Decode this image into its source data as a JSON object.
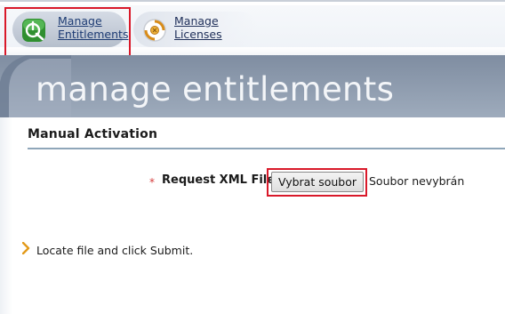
{
  "nav": {
    "tabs": [
      {
        "line1": "Manage",
        "line2": "Entitlements",
        "icon": "entitlements-icon",
        "active": true
      },
      {
        "line1": "Manage",
        "line2": "Licenses",
        "icon": "licenses-icon",
        "active": false
      }
    ]
  },
  "banner": {
    "title": "manage entitlements"
  },
  "section": {
    "title": "Manual Activation"
  },
  "form": {
    "required_marker": "*",
    "field_label": "Request XML File",
    "file_button_label": "Vybrat soubor",
    "file_status": "Soubor nevybrán"
  },
  "hint": {
    "text": "Locate file and click Submit."
  },
  "colors": {
    "highlight": "#d9192a",
    "banner": "#8d9bae",
    "accent_green": "#3aa63a",
    "hint_arrow": "#e29a1a"
  }
}
